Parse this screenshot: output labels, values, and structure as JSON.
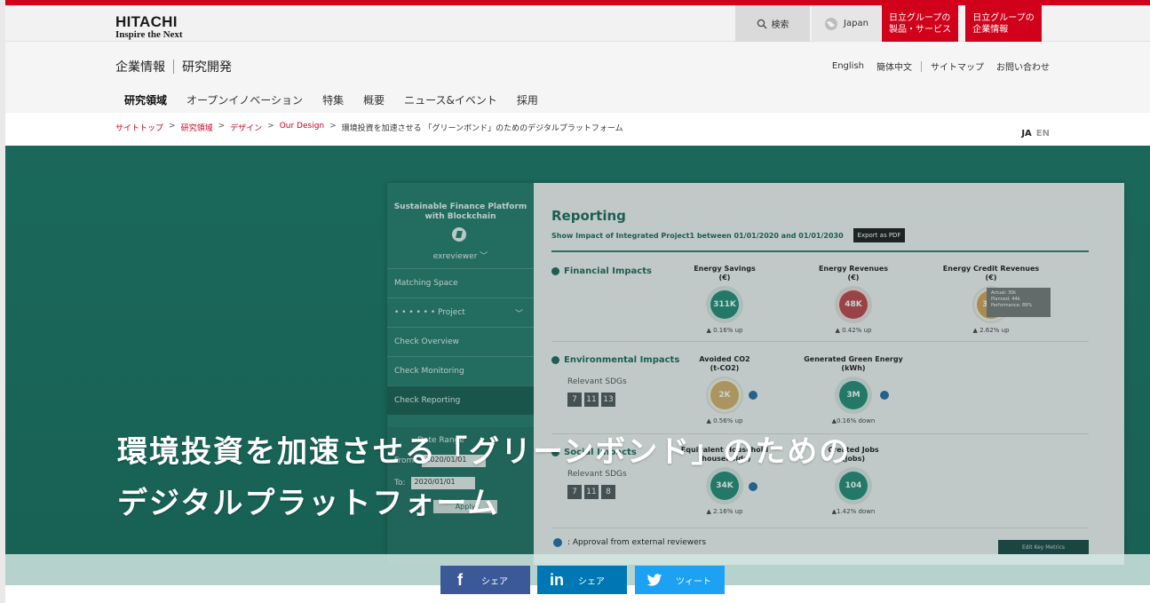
{
  "header": {
    "logo_main": "HITACHI",
    "logo_sub": "Inspire the Next",
    "search_label": "検索",
    "language_label": "Japan",
    "group_products_label": "日立グループの\n製品・サービス",
    "group_corporate_label": "日立グループの\n企業情報"
  },
  "subheader": {
    "title_part1": "企業情報",
    "title_part2": "研究開発",
    "util_links": [
      "English",
      "簡体中文",
      "サイトマップ",
      "お問い合わせ"
    ],
    "nav": [
      "研究領域",
      "オープンイノベーション",
      "特集",
      "概要",
      "ニュース&イベント",
      "採用"
    ]
  },
  "breadcrumb": {
    "items": [
      "サイトトップ",
      "研究領域",
      "デザイン",
      "Our Design"
    ],
    "current": "環境投資を加速させる 「グリーンボンド」のためのデジタルプラットフォーム",
    "separator": ">",
    "lang_ja": "JA",
    "lang_en": "EN"
  },
  "hero": {
    "title_line1": "環境投資を加速させる「グリーンボンド」のための",
    "title_line2": "デジタルプラットフォーム",
    "app": {
      "sidebar_title": "Sustainable Finance Platform\nwith Blockchain",
      "user": "exreviewer",
      "menu": [
        "Matching Space",
        "• • • • • •  Project",
        "Check Overview",
        "Check Monitoring",
        "Check Reporting"
      ],
      "date_range_label": "Date Range",
      "from_label": "From:",
      "from_value": "2020/01/01",
      "to_label": "To:",
      "to_value": "2020/01/01",
      "apply_label": "Apply",
      "reporting_title": "Reporting",
      "reporting_sub": "Show Impact of Integrated Project1 between 01/01/2020 and 01/01/2030",
      "export_label": "Export as PDF",
      "financial_title": "Financial Impacts",
      "environmental_title": "Environmental Impacts",
      "social_title": "Social Impacts",
      "relevant_sdgs": "Relevant SDGs",
      "env_sdgs": [
        "7",
        "11",
        "13"
      ],
      "soc_sdgs": [
        "7",
        "11",
        "8"
      ],
      "metrics": [
        {
          "title": "Energy Savings\n(€)",
          "value": "311K",
          "delta": "▲ 0.16% up",
          "color": "#2a8b78"
        },
        {
          "title": "Energy Revenues\n(€)",
          "value": "48K",
          "delta": "▲ 0.42% up",
          "color": "#c0474e"
        },
        {
          "title": "Energy Credit Revenues\n(€)",
          "value": "39K",
          "delta": "▲ 2.62% up",
          "color": "#d6a45a"
        },
        {
          "title": "Avoided CO2\n(t-CO2)",
          "value": "2K",
          "delta": "▲ 0.56% up",
          "color": "#d6b06e"
        },
        {
          "title": "Generated Green Energy\n(kWh)",
          "value": "3M",
          "delta": "▲0.16% down",
          "color": "#2a8b78"
        },
        {
          "title": "Equivalent Household\n(households)",
          "value": "34K",
          "delta": "▲ 2.16% up",
          "color": "#2a8b78"
        },
        {
          "title": "Created Jobs\n(jobs)",
          "value": "104",
          "delta": "▲1.42% down",
          "color": "#2a8b78"
        }
      ],
      "tooltip": "Actual: 30k\nPlanned: 44k\nPerformance: 89%",
      "approval_text": ": Approval from external reviewers",
      "edit_label": "Edit Key Metrics"
    }
  },
  "share": {
    "facebook": "シェア",
    "linkedin": "シェア",
    "twitter": "ツィート"
  },
  "colors": {
    "brand_red": "#d1001b",
    "hero_teal": "#1f7766",
    "facebook": "#3b5998",
    "linkedin": "#0077b5",
    "twitter": "#1da1f2"
  }
}
